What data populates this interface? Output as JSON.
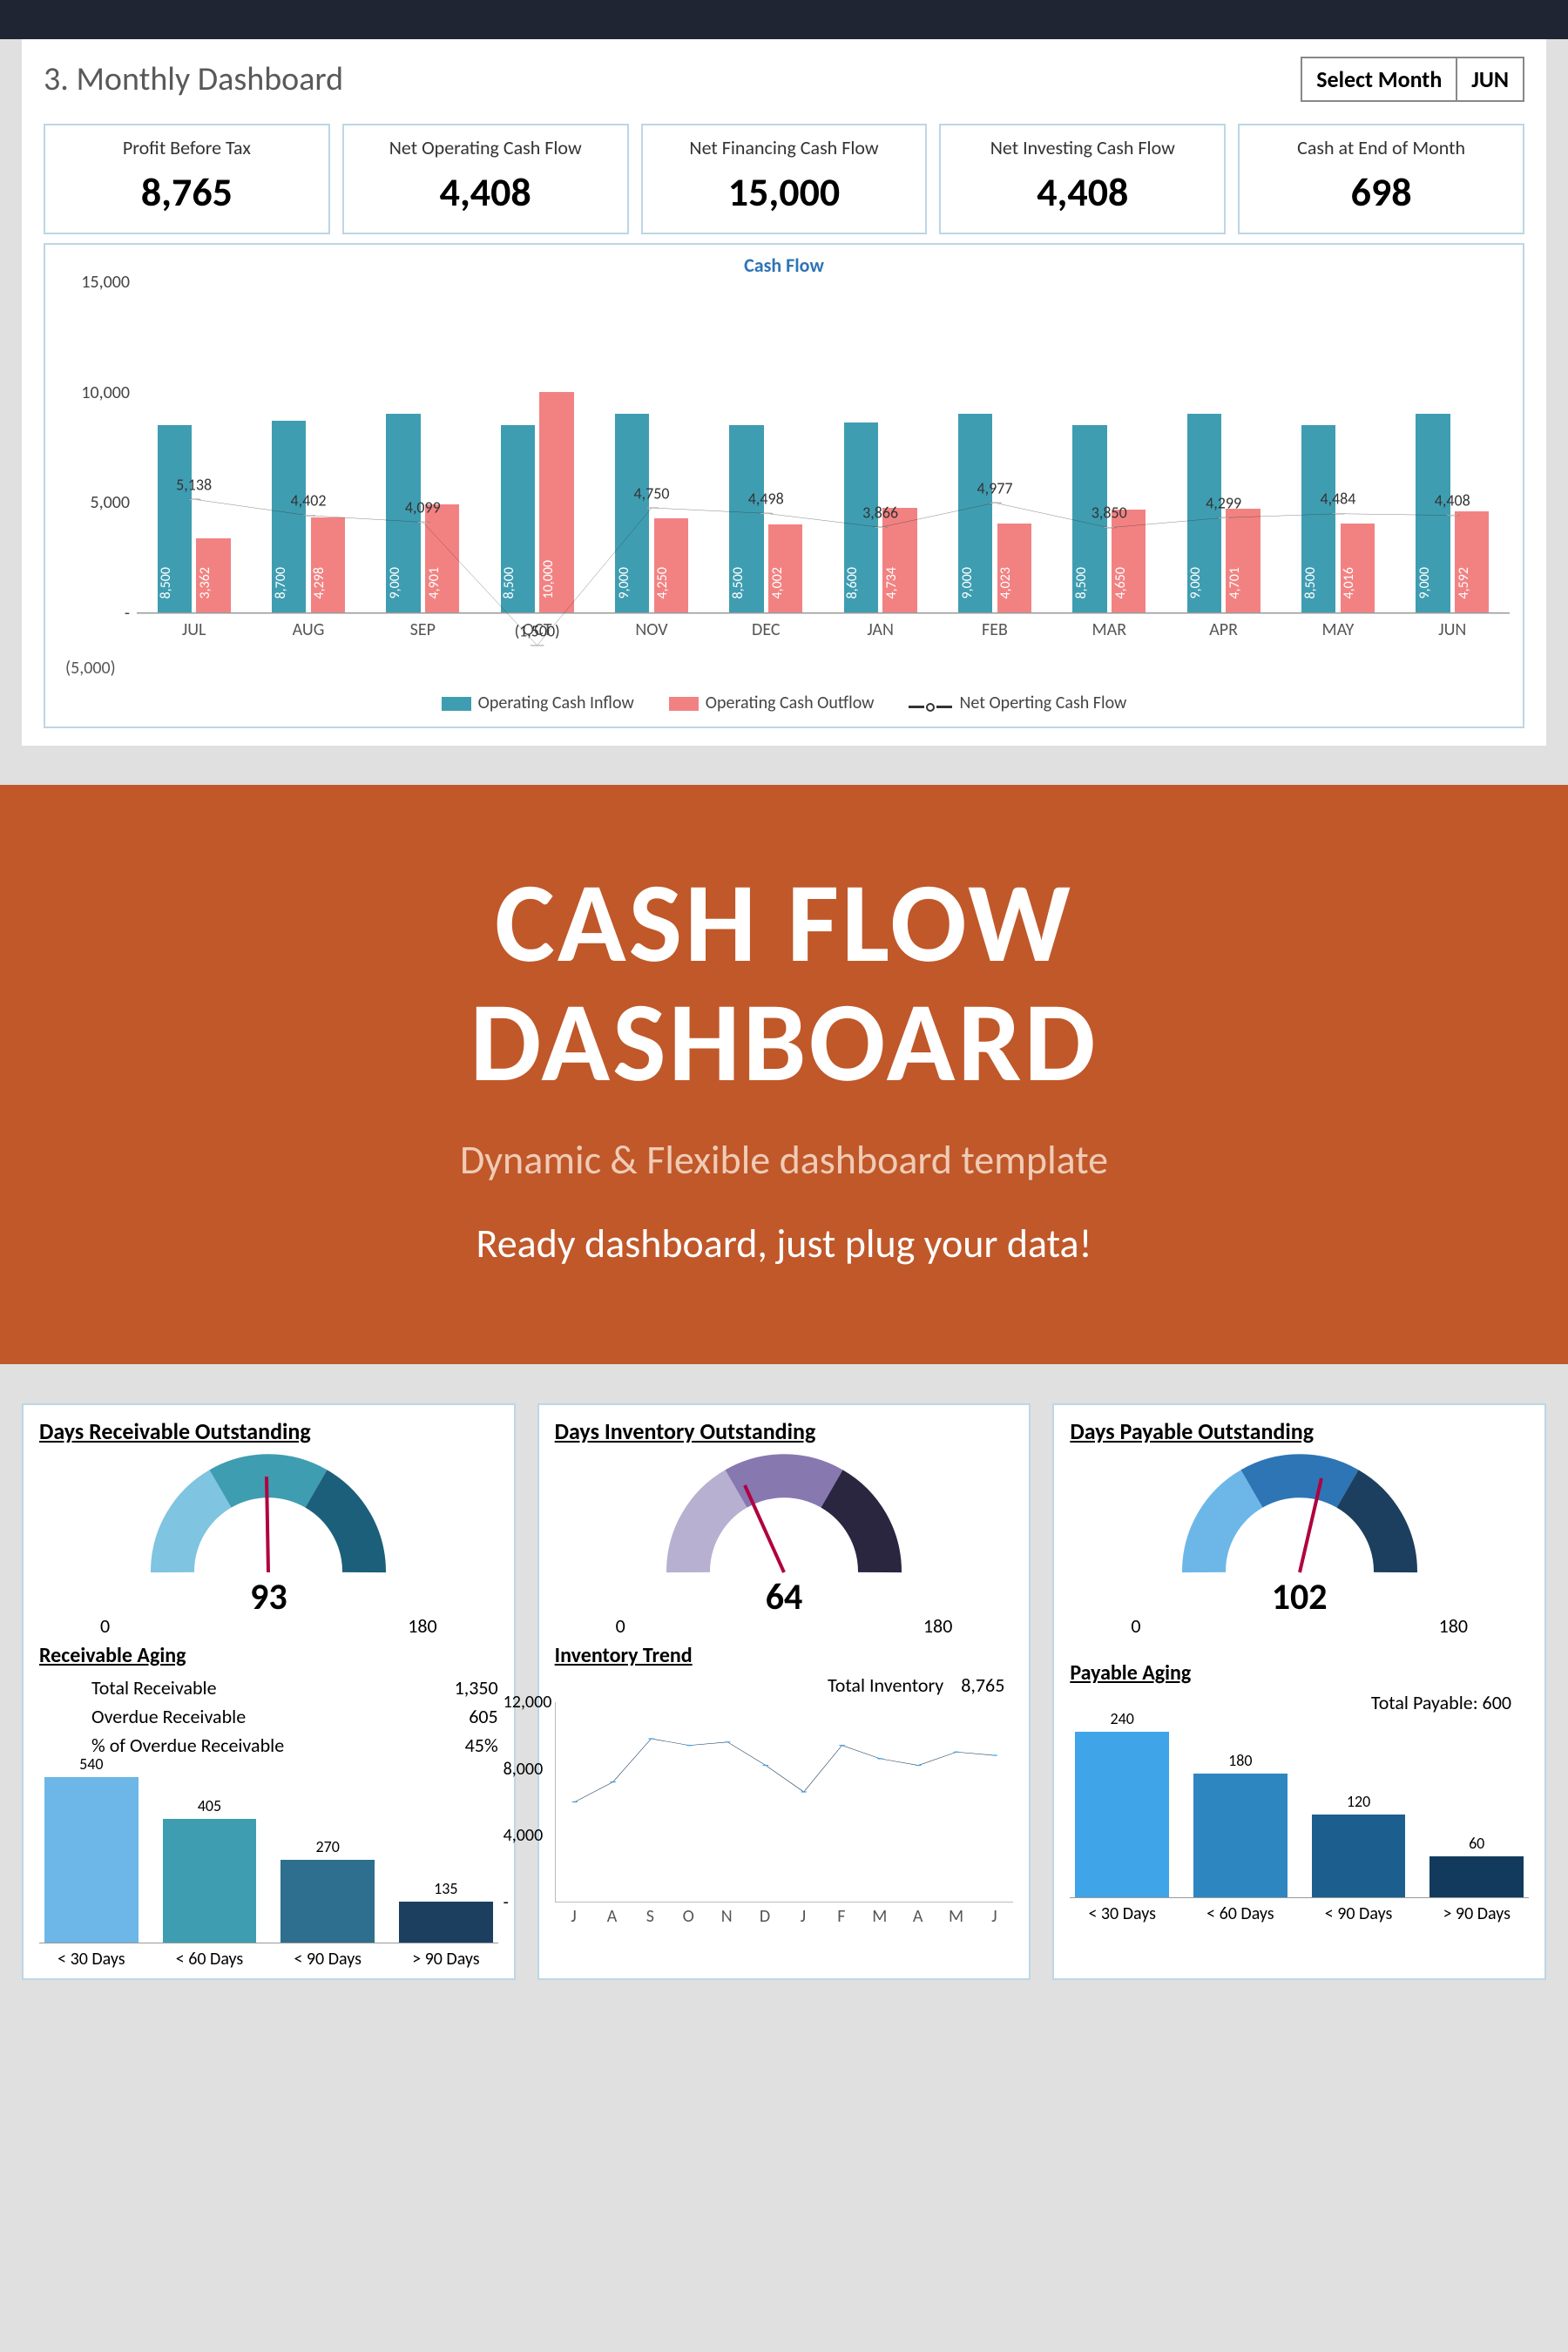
{
  "header": {
    "section_title": "3. Monthly Dashboard",
    "select_label": "Select Month",
    "selected_month": "JUN"
  },
  "kpi": [
    {
      "label": "Profit Before Tax",
      "value": "8,765"
    },
    {
      "label": "Net Operating Cash Flow",
      "value": "4,408"
    },
    {
      "label": "Net Financing Cash Flow",
      "value": "15,000"
    },
    {
      "label": "Net Investing Cash Flow",
      "value": "4,408"
    },
    {
      "label": "Cash at End of Month",
      "value": "698"
    }
  ],
  "chart_data": {
    "type": "bar",
    "title": "Cash Flow",
    "ylim": [
      -5000,
      15000
    ],
    "yticks": [
      "15,000",
      "10,000",
      "5,000",
      "-"
    ],
    "neg_tick": "(5,000)",
    "categories": [
      "JUL",
      "AUG",
      "SEP",
      "OCT",
      "NOV",
      "DEC",
      "JAN",
      "FEB",
      "MAR",
      "APR",
      "MAY",
      "JUN"
    ],
    "series": [
      {
        "name": "Operating Cash Inflow",
        "color": "#3f9db1",
        "values": [
          8500,
          8700,
          9000,
          8500,
          9000,
          8500,
          8600,
          9000,
          8500,
          9000,
          8500,
          9000
        ]
      },
      {
        "name": "Operating Cash Outflow",
        "color": "#f28282",
        "values": [
          3362,
          4298,
          4901,
          10000,
          4250,
          4002,
          4734,
          4023,
          4650,
          4701,
          4016,
          4592
        ]
      },
      {
        "name": "Net Operting Cash Flow",
        "color": "#333333",
        "values": [
          5138,
          4402,
          4099,
          -1500,
          4750,
          4498,
          3866,
          4977,
          3850,
          4299,
          4484,
          4408
        ]
      }
    ],
    "bar_labels": [
      [
        "8,500",
        "3,362"
      ],
      [
        "8,700",
        "4,298"
      ],
      [
        "9,000",
        "4,901"
      ],
      [
        "8,500",
        "10,000"
      ],
      [
        "9,000",
        "4,250"
      ],
      [
        "8,500",
        "4,002"
      ],
      [
        "8,600",
        "4,734"
      ],
      [
        "9,000",
        "4,023"
      ],
      [
        "8,500",
        "4,650"
      ],
      [
        "9,000",
        "4,701"
      ],
      [
        "8,500",
        "4,016"
      ],
      [
        "9,000",
        "4,592"
      ]
    ],
    "net_labels": [
      "5,138",
      "4,402",
      "4,099",
      "(1,500)",
      "4,750",
      "4,498",
      "3,866",
      "4,977",
      "3,850",
      "4,299",
      "4,484",
      "4,408"
    ],
    "legend": [
      "Operating Cash Inflow",
      "Operating Cash Outflow",
      "Net Operting Cash Flow"
    ]
  },
  "banner": {
    "title_l1": "CASH FLOW",
    "title_l2": "DASHBOARD",
    "sub1": "Dynamic & Flexible dashboard template",
    "sub2": "Ready dashboard, just plug your data!"
  },
  "gauges": {
    "receivable": {
      "title": "Days Receivable Outstanding",
      "value": "93",
      "min": "0",
      "max": "180"
    },
    "inventory": {
      "title": "Days Inventory Outstanding",
      "value": "64",
      "min": "0",
      "max": "180"
    },
    "payable": {
      "title": "Days Payable Outstanding",
      "value": "102",
      "min": "0",
      "max": "180"
    }
  },
  "receivable_aging": {
    "title": "Receivable Aging",
    "stats": [
      {
        "label": "Total Receivable",
        "value": "1,350"
      },
      {
        "label": "Overdue Receivable",
        "value": "605"
      },
      {
        "label": "% of Overdue Receivable",
        "value": "45%"
      }
    ],
    "chart_data": {
      "type": "bar",
      "categories": [
        "< 30 Days",
        "< 60 Days",
        "< 90 Days",
        "> 90 Days"
      ],
      "values": [
        540,
        405,
        270,
        135
      ],
      "colors": [
        "#6db7e8",
        "#3f9db1",
        "#2e6e8e",
        "#1c3f5f"
      ]
    }
  },
  "inventory_trend": {
    "title": "Inventory Trend",
    "total_label": "Total Inventory",
    "total_value": "8,765",
    "chart_data": {
      "type": "line",
      "yticks": [
        "12,000",
        "8,000",
        "4,000",
        "-"
      ],
      "ylim": [
        0,
        12000
      ],
      "categories": [
        "J",
        "A",
        "S",
        "O",
        "N",
        "D",
        "J",
        "F",
        "M",
        "A",
        "M",
        "J"
      ],
      "values": [
        6000,
        7200,
        9800,
        9400,
        9600,
        8200,
        6600,
        9400,
        8600,
        8200,
        9000,
        8800
      ]
    }
  },
  "payable_aging": {
    "title": "Payable Aging",
    "total_label": "Total Payable: 600",
    "chart_data": {
      "type": "bar",
      "categories": [
        "< 30 Days",
        "< 60 Days",
        "< 90 Days",
        "> 90 Days"
      ],
      "values": [
        240,
        180,
        120,
        60
      ],
      "colors": [
        "#3fa4e8",
        "#2e86c1",
        "#1c5f8e",
        "#123a5c"
      ]
    }
  }
}
